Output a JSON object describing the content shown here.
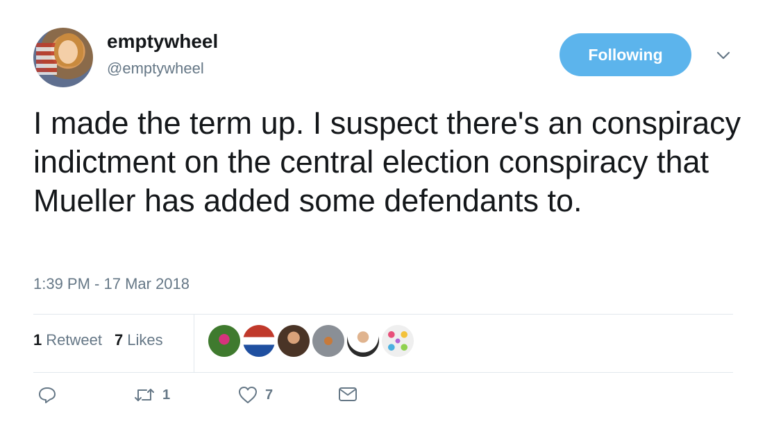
{
  "author": {
    "display_name": "emptywheel",
    "handle": "@emptywheel"
  },
  "follow_button": {
    "label": "Following",
    "color": "#5cb4ec"
  },
  "tweet": {
    "text": "I made the term up. I suspect there's an conspiracy indictment on the central election conspiracy that Mueller has added some defendants to.",
    "timestamp": "1:39 PM - 17 Mar 2018"
  },
  "stats": {
    "retweets_count": "1",
    "retweets_label": "Retweet",
    "likes_count": "7",
    "likes_label": "Likes"
  },
  "actions": {
    "reply_icon": "reply-icon",
    "retweet_icon": "retweet-icon",
    "retweet_count": "1",
    "like_icon": "heart-icon",
    "like_count": "7",
    "dm_icon": "envelope-icon"
  },
  "colors": {
    "text": "#14171a",
    "secondary": "#657786",
    "divider": "#e1e8ed"
  }
}
